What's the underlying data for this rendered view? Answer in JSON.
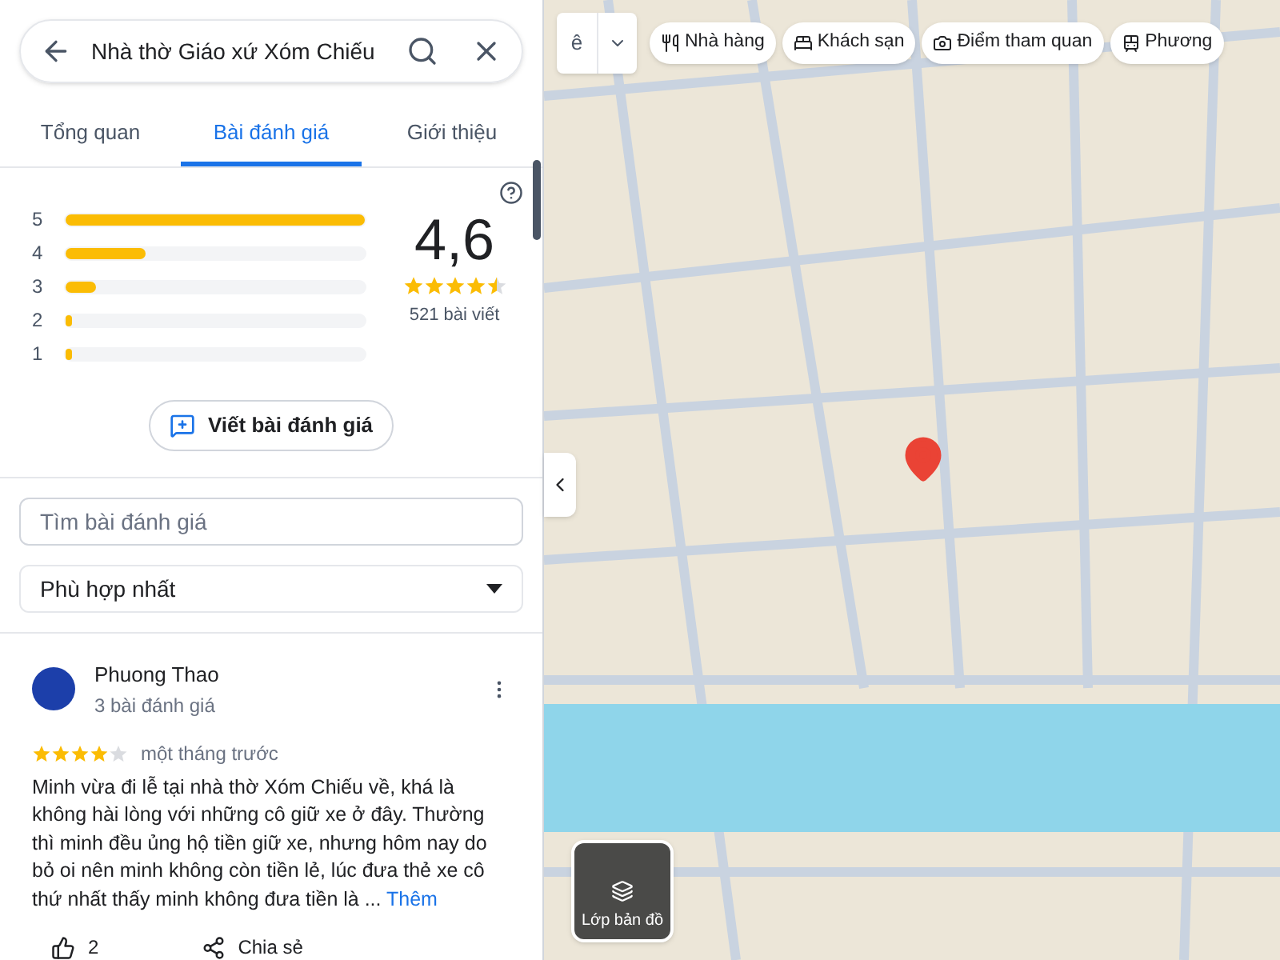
{
  "search": {
    "value": "Nhà thờ Giáo xứ Xóm Chiếu"
  },
  "tabs": [
    {
      "label": "Tổng quan",
      "selected": false
    },
    {
      "label": "Bài đánh giá",
      "selected": true
    },
    {
      "label": "Giới thiệu",
      "selected": false
    }
  ],
  "rating_summary": {
    "bars": [
      {
        "label": "5",
        "level": 1.0
      },
      {
        "label": "4",
        "level": 0.27
      },
      {
        "label": "3",
        "level": 0.1
      },
      {
        "label": "2",
        "level": 0.02
      },
      {
        "label": "1",
        "level": 0.01
      }
    ],
    "average": "4,6",
    "stars": 4.5,
    "count": "521 bài viết",
    "write_button": "Viết bài đánh giá"
  },
  "review_search": {
    "placeholder": "Tìm bài đánh giá"
  },
  "sort": {
    "value": "Phù hợp nhất"
  },
  "reviews": [
    {
      "author": "Phuong Thao",
      "author_meta": "3 bài đánh giá",
      "stars": 4,
      "time": "một tháng trước",
      "text": "Minh vừa đi lễ tại nhà thờ Xóm Chiếu về, khá là không hài lòng với những cô giữ xe ở đây. Thường thì minh đều ủng hộ tiền giữ xe, nhưng hôm nay do bỏ oi nên minh không còn tiền lẻ, lúc đưa thẻ xe cô thứ nhất thấy minh không đưa tiền là ...",
      "more": "Thêm",
      "likes": "2",
      "share": "Chia sẻ"
    }
  ],
  "map": {
    "type_control": "ê",
    "chips": [
      {
        "kind": "restaurant",
        "label": "Nhà hàng"
      },
      {
        "kind": "hotel",
        "label": "Khách sạn"
      },
      {
        "kind": "attraction",
        "label": "Điểm tham quan"
      },
      {
        "kind": "transit",
        "label": "Phương"
      }
    ],
    "layers_button": "Lớp bản đồ"
  }
}
